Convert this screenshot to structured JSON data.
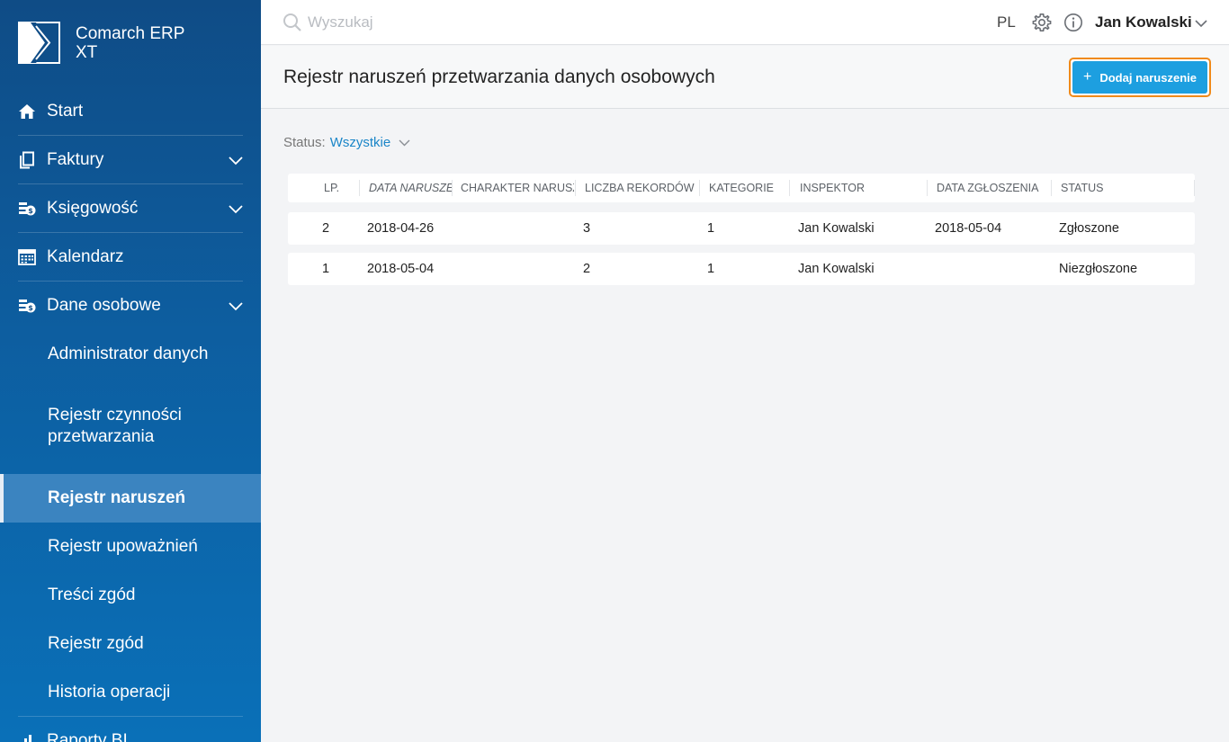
{
  "app": {
    "name_line1": "Comarch ERP",
    "name_line2": "XT"
  },
  "sidebar": {
    "items": [
      {
        "label": "Start",
        "icon": "home-icon"
      },
      {
        "label": "Faktury",
        "icon": "document-icon"
      },
      {
        "label": "Księgowość",
        "icon": "accounting-icon"
      },
      {
        "label": "Kalendarz",
        "icon": "calendar-icon"
      },
      {
        "label": "Dane osobowe",
        "icon": "personal-data-icon"
      }
    ],
    "subitems": [
      {
        "label": "Administrator danych"
      },
      {
        "label": "Rejestr czynności przetwarzania"
      },
      {
        "label": "Rejestr naruszeń"
      },
      {
        "label": "Rejestr upoważnień"
      },
      {
        "label": "Treści zgód"
      },
      {
        "label": "Rejestr zgód"
      },
      {
        "label": "Historia operacji"
      }
    ],
    "bottom": {
      "label": "Raporty BI",
      "icon": "bar-chart-icon"
    }
  },
  "topbar": {
    "search_placeholder": "Wyszukaj",
    "language": "PL",
    "user_name": "Jan Kowalski"
  },
  "page": {
    "title": "Rejestr naruszeń przetwarzania danych osobowych",
    "add_button": "Dodaj naruszenie"
  },
  "filter": {
    "label": "Status:",
    "value": "Wszystkie"
  },
  "table": {
    "columns": [
      "LP.",
      "DATA NARUSZENIA",
      "CHARAKTER NARUSZENIA",
      "LICZBA REKORDÓW",
      "KATEGORIE",
      "INSPEKTOR",
      "DATA ZGŁOSZENIA",
      "STATUS"
    ],
    "rows": [
      {
        "lp": "2",
        "data_naruszenia": "2018-04-26",
        "charakter": "",
        "liczba": "3",
        "kategorie": "1",
        "inspektor": "Jan Kowalski",
        "data_zgloszenia": "2018-05-04",
        "status": "Zgłoszone"
      },
      {
        "lp": "1",
        "data_naruszenia": "2018-05-04",
        "charakter": "",
        "liczba": "2",
        "kategorie": "1",
        "inspektor": "Jan Kowalski",
        "data_zgloszenia": "",
        "status": "Niezgłoszone"
      }
    ]
  },
  "colors": {
    "sidebar_top": "#0f4c86",
    "sidebar_bottom": "#0a70b8",
    "accent": "#1d9fe0",
    "focus": "#f08a1a",
    "active_item": "#3b84c0"
  }
}
